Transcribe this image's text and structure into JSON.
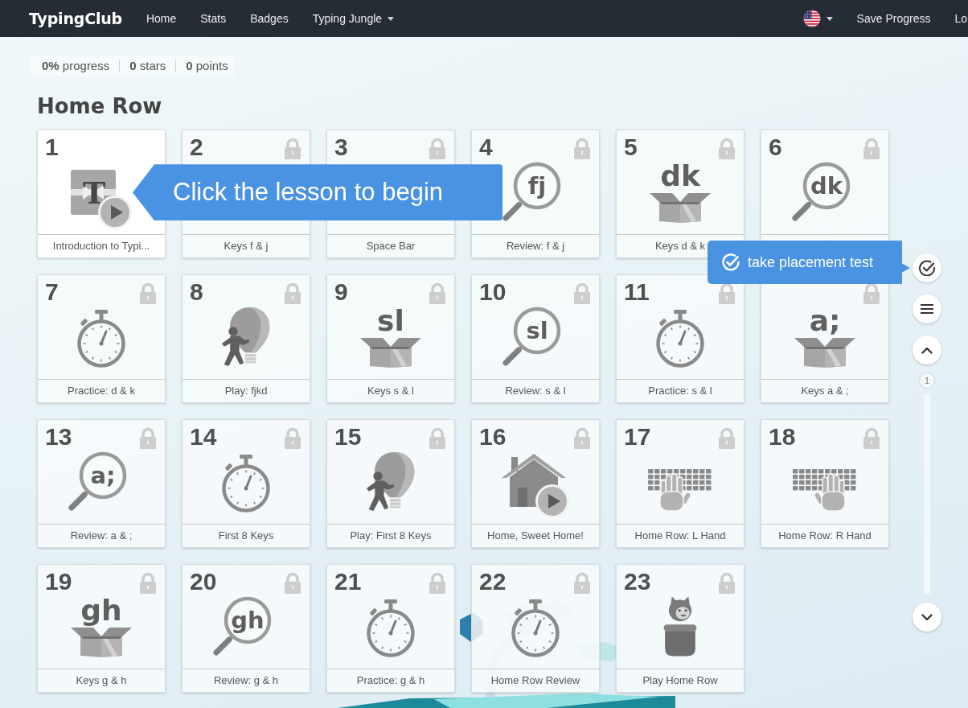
{
  "navbar": {
    "brand": "TypingClub",
    "links": [
      {
        "label": "Home",
        "dropdown": false
      },
      {
        "label": "Stats",
        "dropdown": false
      },
      {
        "label": "Badges",
        "dropdown": false
      },
      {
        "label": "Typing Jungle",
        "dropdown": true
      }
    ],
    "language_menu": {
      "dropdown": true
    },
    "right_links": [
      "Save Progress",
      "Lo"
    ]
  },
  "stats": [
    "**0%** progress",
    "**0** stars",
    "**0** points"
  ],
  "section": {
    "title": "Home Row",
    "lessons": [
      {
        "number": "1",
        "title": "Introduction to Typi...",
        "locked": false,
        "kind": "intro",
        "icon_text": "T"
      },
      {
        "number": "2",
        "title": "Keys f & j",
        "locked": true
      },
      {
        "number": "3",
        "title": "Space Bar",
        "locked": true
      },
      {
        "number": "4",
        "title": "Review: f & j",
        "locked": true,
        "kind": "review",
        "icon_text": "fj"
      },
      {
        "number": "5",
        "title": "Keys d & k",
        "locked": true,
        "kind": "keys",
        "icon_text": "dk"
      },
      {
        "number": "6",
        "locked": true,
        "kind": "review",
        "icon_text": "dk"
      },
      {
        "number": "7",
        "title": "Practice: d & k",
        "locked": true,
        "kind": "practice"
      },
      {
        "number": "8",
        "title": "Play: fjkd",
        "locked": true,
        "kind": "game"
      },
      {
        "number": "9",
        "title": "Keys s & l",
        "locked": true,
        "kind": "keys",
        "icon_text": "sl"
      },
      {
        "number": "10",
        "title": "Review: s & l",
        "locked": true,
        "kind": "review",
        "icon_text": "sl"
      },
      {
        "number": "11",
        "title": "Practice: s & l",
        "locked": true,
        "kind": "practice"
      },
      {
        "title": "Keys a & ;",
        "locked": true,
        "kind": "keys",
        "icon_text": "a;"
      },
      {
        "number": "13",
        "title": "Review: a & ;",
        "locked": true,
        "kind": "review",
        "icon_text": "a;"
      },
      {
        "number": "14",
        "title": "First 8 Keys",
        "locked": true,
        "kind": "practice"
      },
      {
        "number": "15",
        "title": "Play: First 8 Keys",
        "locked": true,
        "kind": "game"
      },
      {
        "number": "16",
        "title": "Home, Sweet Home!",
        "locked": true,
        "kind": "video"
      },
      {
        "number": "17",
        "title": "Home Row: L Hand",
        "locked": true,
        "kind": "left_hand"
      },
      {
        "number": "18",
        "title": "Home Row: R Hand",
        "locked": true,
        "kind": "right_hand"
      },
      {
        "number": "19",
        "title": "Keys g & h",
        "locked": true,
        "kind": "keys",
        "icon_text": "gh"
      },
      {
        "number": "20",
        "title": "Review: g & h",
        "locked": true,
        "kind": "review",
        "icon_text": "gh"
      },
      {
        "number": "21",
        "title": "Practice: g & h",
        "locked": true,
        "kind": "practice"
      },
      {
        "number": "22",
        "title": "Home Row Review",
        "locked": true,
        "kind": "practice"
      },
      {
        "number": "23",
        "title": "Play Home Row",
        "locked": true,
        "kind": "finale"
      }
    ]
  },
  "lesson_hint": "Click the lesson to begin",
  "side_rail": {
    "placement_test": "take placement test",
    "page_marker": "1"
  }
}
